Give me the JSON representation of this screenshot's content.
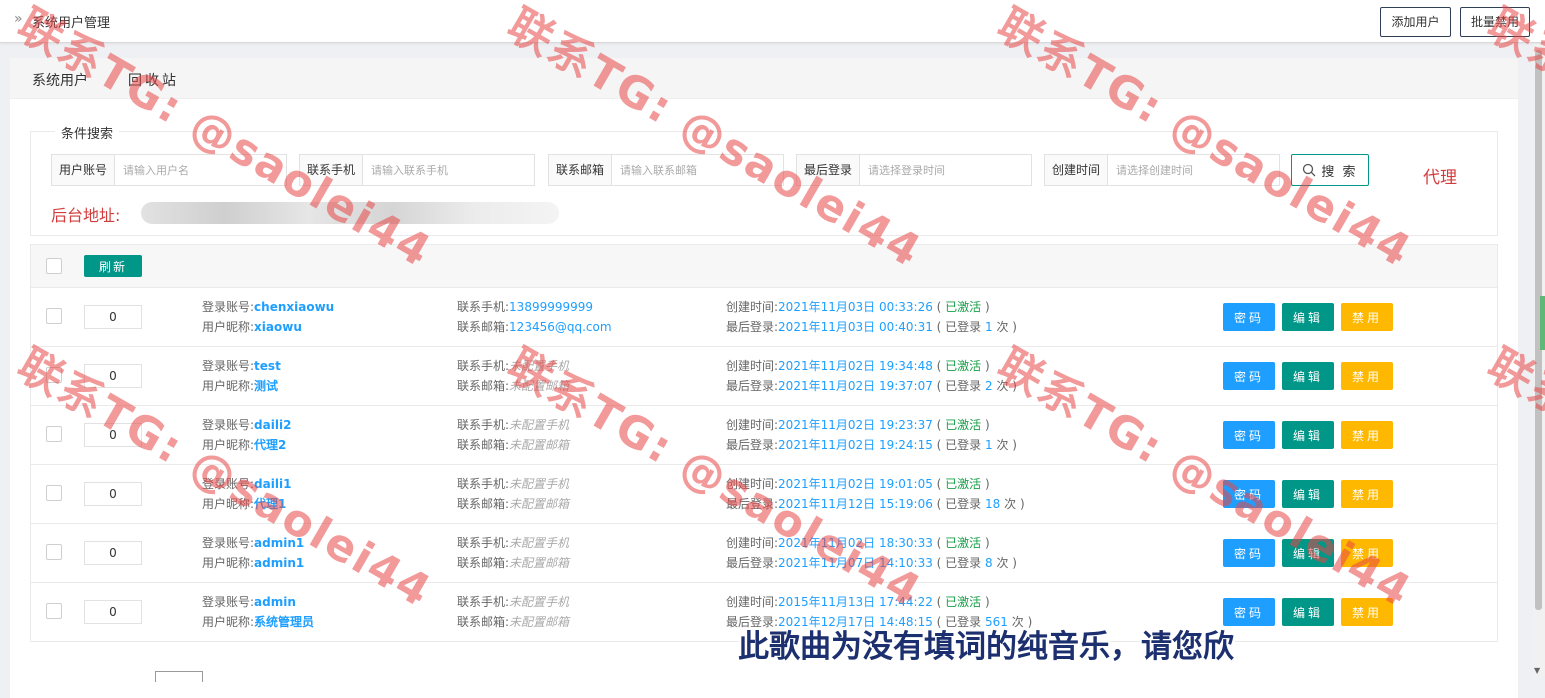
{
  "header": {
    "breadcrumb_icon": "»",
    "title": "系统用户管理",
    "add_user_label": "添加用户",
    "batch_disable_label": "批量禁用"
  },
  "tabs": [
    {
      "label": "系统用户",
      "active": true
    },
    {
      "label": "回收站",
      "active": false
    }
  ],
  "search": {
    "legend": "条件搜索",
    "fields": [
      {
        "label": "用户账号",
        "placeholder": "请输入用户名"
      },
      {
        "label": "联系手机",
        "placeholder": "请输入联系手机"
      },
      {
        "label": "联系邮箱",
        "placeholder": "请输入联系邮箱"
      },
      {
        "label": "最后登录",
        "placeholder": "请选择登录时间"
      },
      {
        "label": "创建时间",
        "placeholder": "请选择创建时间"
      }
    ],
    "search_label": "搜 索",
    "agent_note": "代理",
    "backend_address_label": "后台地址:"
  },
  "table": {
    "refresh_label": "刷新",
    "labels": {
      "account": "登录账号:",
      "nickname": "用户昵称:",
      "phone": "联系手机:",
      "email": "联系邮箱:",
      "created": "创建时间:",
      "last_login": "最后登录:"
    },
    "rows": [
      {
        "sort": "0",
        "account": "chenxiaowu",
        "nickname": "xiaowu",
        "phone": "13899999999",
        "email": "123456@qq.com",
        "created": "2021年11月03日 00:33:26",
        "status": "已激活",
        "last_login": "2021年11月03日 00:40:31",
        "login_prefix": "已登录",
        "login_count": "1",
        "login_suffix": "次"
      },
      {
        "sort": "0",
        "account": "test",
        "nickname": "测试",
        "phone": "未配置手机",
        "email": "未配置邮箱",
        "created": "2021年11月02日 19:34:48",
        "status": "已激活",
        "last_login": "2021年11月02日 19:37:07",
        "login_prefix": "已登录",
        "login_count": "2",
        "login_suffix": "次"
      },
      {
        "sort": "0",
        "account": "daili2",
        "nickname": "代理2",
        "phone": "未配置手机",
        "email": "未配置邮箱",
        "created": "2021年11月02日 19:23:37",
        "status": "已激活",
        "last_login": "2021年11月02日 19:24:15",
        "login_prefix": "已登录",
        "login_count": "1",
        "login_suffix": "次"
      },
      {
        "sort": "0",
        "account": "daili1",
        "nickname": "代理1",
        "phone": "未配置手机",
        "email": "未配置邮箱",
        "created": "2021年11月02日 19:01:05",
        "status": "已激活",
        "last_login": "2021年11月12日 15:19:06",
        "login_prefix": "已登录",
        "login_count": "18",
        "login_suffix": "次"
      },
      {
        "sort": "0",
        "account": "admin1",
        "nickname": "admin1",
        "phone": "未配置手机",
        "email": "未配置邮箱",
        "created": "2021年11月02日 18:30:33",
        "status": "已激活",
        "last_login": "2021年11月07日 14:10:33",
        "login_prefix": "已登录",
        "login_count": "8",
        "login_suffix": "次"
      },
      {
        "sort": "0",
        "account": "admin",
        "nickname": "系统管理员",
        "phone": "未配置手机",
        "email": "未配置邮箱",
        "created": "2015年11月13日 17:44:22",
        "status": "已激活",
        "last_login": "2021年12月17日 14:48:15",
        "login_prefix": "已登录",
        "login_count": "561",
        "login_suffix": "次"
      }
    ],
    "actions": {
      "password": "密码",
      "edit": "编辑",
      "disable": "禁用"
    }
  },
  "overlay": {
    "subtitle": "此歌曲为没有填词的纯音乐，请您欣",
    "watermark": "联系TG: @saolei44"
  },
  "colors": {
    "primary_teal": "#009688",
    "blue": "#1e9fff",
    "warning": "#ffb800",
    "active_green": "#18a049",
    "note_red": "#d33c3c"
  }
}
